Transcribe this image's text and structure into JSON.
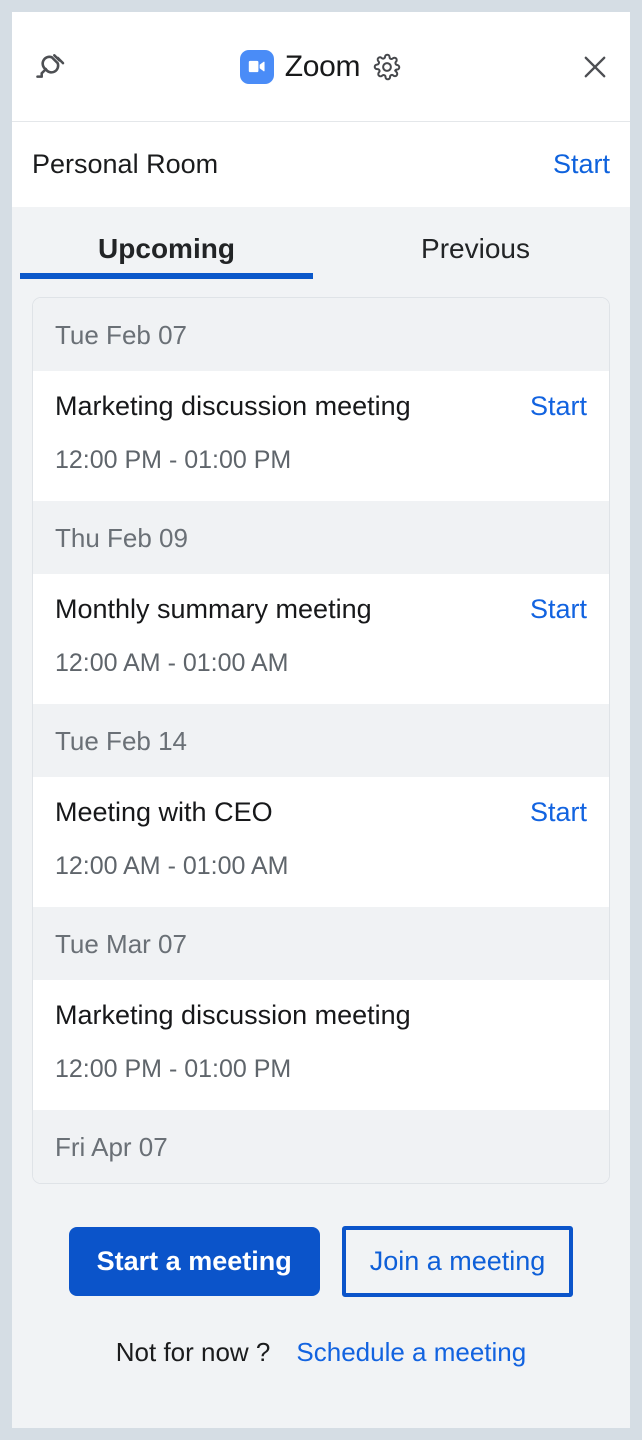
{
  "window": {
    "titlebar": {
      "plug_icon": "plug-icon",
      "brand_logo_icon": "video-camera-icon",
      "brand_name": "Zoom",
      "settings_icon": "gear-icon",
      "close_icon": "close-icon",
      "brand_color": "#4a8cf7"
    },
    "personal_room": {
      "label": "Personal Room",
      "start_label": "Start"
    },
    "tabs": [
      {
        "label": "Upcoming",
        "active": true
      },
      {
        "label": "Previous",
        "active": false
      }
    ],
    "meeting_list": [
      {
        "date": "Tue Feb 07",
        "title": "Marketing discussion meeting",
        "time": "12:00 PM - 01:00 PM",
        "start_label": "Start"
      },
      {
        "date": "Thu Feb 09",
        "title": "Monthly summary meeting",
        "time": "12:00 AM - 01:00 AM",
        "start_label": "Start"
      },
      {
        "date": "Tue Feb 14",
        "title": "Meeting with CEO",
        "time": "12:00 AM - 01:00 AM",
        "start_label": "Start"
      },
      {
        "date": "Tue Mar 07",
        "title": "Marketing discussion meeting",
        "time": "12:00 PM - 01:00 PM",
        "start_label": ""
      },
      {
        "date": "Fri Apr 07",
        "title": "",
        "time": "",
        "start_label": ""
      }
    ],
    "actions": {
      "start_meeting_label": "Start a meeting",
      "join_meeting_label": "Join a meeting"
    },
    "footnote": {
      "text": "Not for now ?",
      "link_label": "Schedule a meeting"
    },
    "colors": {
      "accent_blue": "#0b54ca",
      "link_blue": "#1263e0",
      "logo_blue": "#4a8cf7",
      "page_bg": "#f1f3f5",
      "outer_bg": "#d5dde4"
    }
  }
}
